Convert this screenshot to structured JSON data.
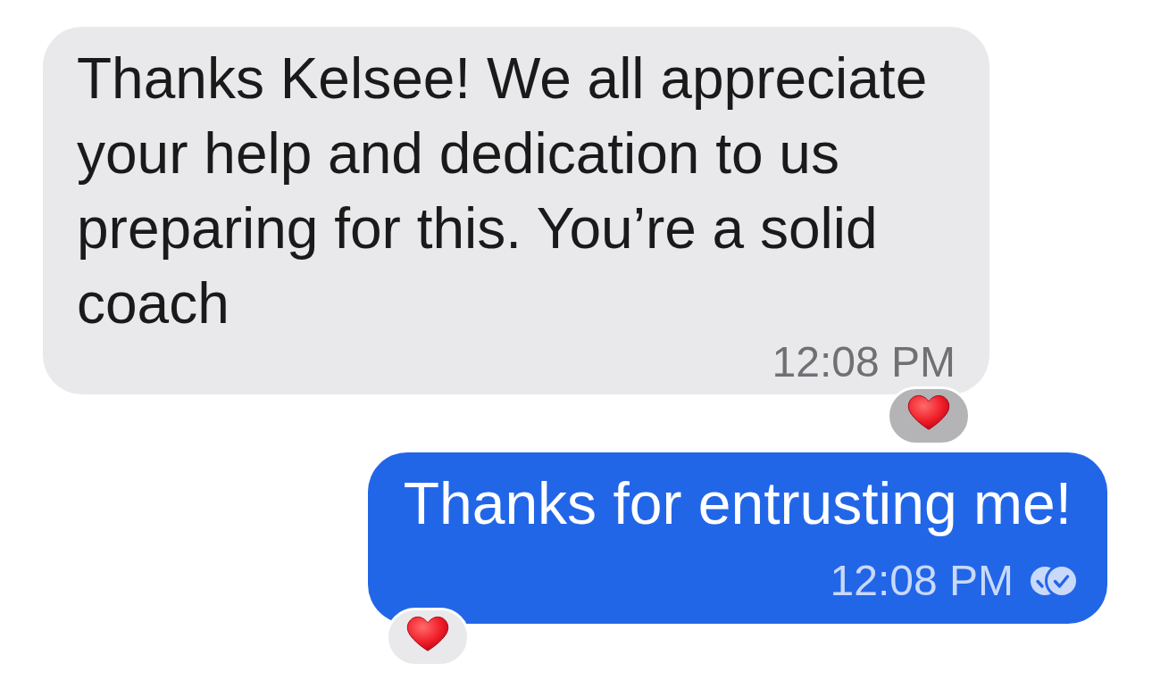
{
  "messages": [
    {
      "kind": "incoming",
      "text": "Thanks Kelsee! We all appreciate your help and dedication to us preparing for this. You’re a solid coach",
      "time": "12:08 PM",
      "reaction": {
        "mine": true
      }
    },
    {
      "kind": "outgoing",
      "text": "Thanks for entrusting me!",
      "time": "12:08 PM",
      "read": true,
      "reaction": {
        "mine": false
      }
    }
  ]
}
